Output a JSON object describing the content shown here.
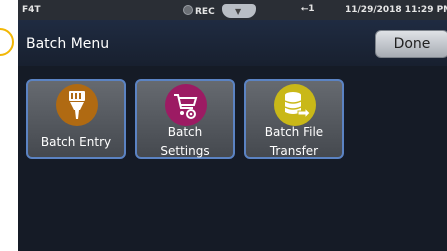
{
  "status": {
    "device": "F4T",
    "rec": "REC",
    "usb": "1",
    "datetime": "11/29/2018 11:29 PM"
  },
  "header": {
    "title": "Batch Menu",
    "done_label": "Done"
  },
  "tiles": [
    {
      "lines": [
        "Batch Entry"
      ],
      "icon": "brush-icon",
      "color": "#b06a12"
    },
    {
      "lines": [
        "Batch",
        "Settings"
      ],
      "icon": "cart-gear-icon",
      "color": "#9c1b63"
    },
    {
      "lines": [
        "Batch File",
        "Transfer"
      ],
      "icon": "database-transfer-icon",
      "color": "#c9b818"
    }
  ],
  "colors": {
    "accent": "#5b83c3",
    "background": "#151b26"
  }
}
